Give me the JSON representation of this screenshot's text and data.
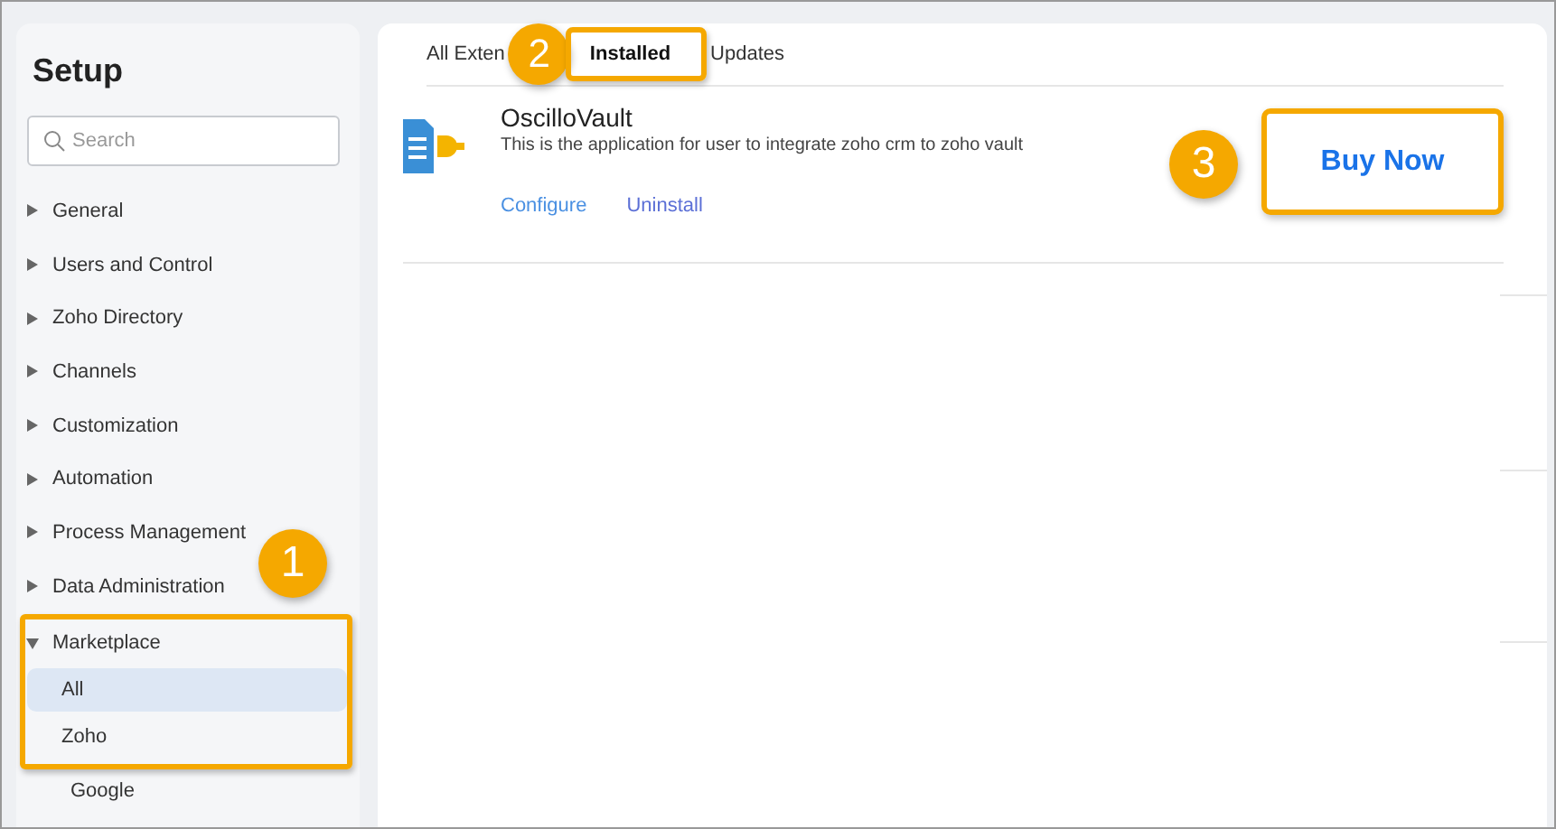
{
  "sidebar": {
    "title": "Setup",
    "search": {
      "placeholder": "Search"
    },
    "items": [
      {
        "label": "General",
        "expanded": false,
        "highlighted": false
      },
      {
        "label": "Users and Control",
        "expanded": false,
        "highlighted": false
      },
      {
        "label": "Zoho Directory",
        "expanded": false,
        "highlighted": false
      },
      {
        "label": "Channels",
        "expanded": false,
        "highlighted": false
      },
      {
        "label": "Customization",
        "expanded": false,
        "highlighted": false
      },
      {
        "label": "Automation",
        "expanded": false,
        "highlighted": false
      },
      {
        "label": "Process Management",
        "expanded": false,
        "highlighted": false
      },
      {
        "label": "Data Administration",
        "expanded": false,
        "highlighted": false
      },
      {
        "label": "Marketplace",
        "expanded": true,
        "highlighted": true,
        "children": [
          {
            "label": "All",
            "selected": true,
            "highlighted": true
          },
          {
            "label": "Zoho",
            "selected": false,
            "highlighted": true
          },
          {
            "label": "Google",
            "selected": false,
            "highlighted": false
          }
        ]
      }
    ]
  },
  "tabs": [
    {
      "label": "All Exten",
      "selected": false,
      "highlighted": false
    },
    {
      "label": "Installed",
      "selected": true,
      "highlighted": true
    },
    {
      "label": "Updates",
      "selected": false,
      "highlighted": false
    }
  ],
  "extension": {
    "name": "OscilloVault",
    "description": "This is the application for user to integrate zoho crm to zoho vault",
    "actions": [
      "Configure",
      "Uninstall"
    ],
    "buy_button": "Buy Now"
  },
  "callouts": [
    "1",
    "2",
    "3"
  ]
}
